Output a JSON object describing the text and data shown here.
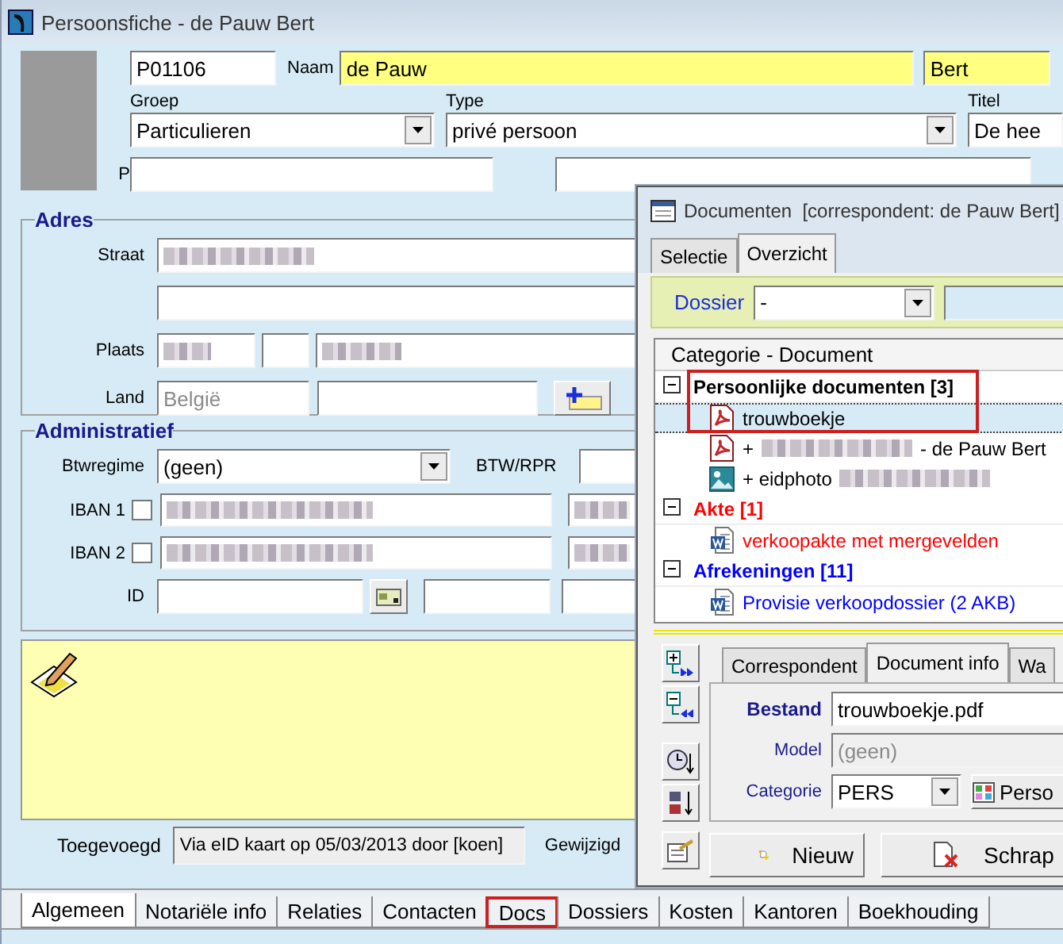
{
  "window": {
    "title": "Persoonsfiche - de Pauw Bert"
  },
  "header": {
    "code": "P01106",
    "name_label": "Naam",
    "name": "de Pauw",
    "first_name": "Bert",
    "group_label": "Groep",
    "group": "Particulieren",
    "type_label": "Type",
    "type": "privé persoon",
    "title_label": "Titel",
    "title": "De hee",
    "p_label": "P"
  },
  "address": {
    "heading": "Adres",
    "street_label": "Straat",
    "place_label": "Plaats",
    "country_label": "Land",
    "country": "België"
  },
  "administrative": {
    "heading": "Administratief",
    "vat_regime_label": "Btwregime",
    "vat_regime": "(geen)",
    "vat_label": "BTW/RPR",
    "id_label": "ID",
    "iban_rows": [
      {
        "label": "IBAN 1",
        "checked": false
      },
      {
        "label": "IBAN 2",
        "checked": false
      }
    ]
  },
  "footer": {
    "added_label": "Toegevoegd",
    "added": "Via eID kaart op 05/03/2013 door [koen]",
    "modified_label": "Gewijzigd"
  },
  "tabs": [
    {
      "label": "Algemeen",
      "selected": true,
      "highlighted": false
    },
    {
      "label": "Notariële info",
      "selected": false,
      "highlighted": false
    },
    {
      "label": "Relaties",
      "selected": false,
      "highlighted": false
    },
    {
      "label": "Contacten",
      "selected": false,
      "highlighted": false
    },
    {
      "label": "Docs",
      "selected": false,
      "highlighted": true
    },
    {
      "label": "Dossiers",
      "selected": false,
      "highlighted": false
    },
    {
      "label": "Kosten",
      "selected": false,
      "highlighted": false
    },
    {
      "label": "Kantoren",
      "selected": false,
      "highlighted": false
    },
    {
      "label": "Boekhouding",
      "selected": false,
      "highlighted": false
    }
  ],
  "documents_window": {
    "title": "Documenten  [correspondent: de Pauw Bert]",
    "tabs": [
      {
        "label": "Selectie",
        "selected": false
      },
      {
        "label": "Overzicht",
        "selected": true
      }
    ],
    "dossier_label": "Dossier",
    "dossier": "-",
    "tree_header": "Categorie - Document",
    "categories": [
      {
        "label": "Persoonlijke documenten [3]",
        "color": "#000000",
        "expanded": true,
        "highlighted": true,
        "children": [
          {
            "kind": "pdf",
            "prefix": "trouwboekje",
            "redacted": false,
            "selected": true
          },
          {
            "kind": "pdf",
            "prefix": "+",
            "redacted": true,
            "suffix": "- de Pauw Bert",
            "selected": false
          },
          {
            "kind": "image",
            "prefix": "+ eidphoto",
            "redacted": true,
            "selected": false
          }
        ]
      },
      {
        "label": "Akte [1]",
        "color": "#ff0000",
        "expanded": true,
        "highlighted": false,
        "children": [
          {
            "kind": "word",
            "prefix": "verkoopakte met mergevelden",
            "redacted": false,
            "selected": false
          }
        ]
      },
      {
        "label": "Afrekeningen [11]",
        "color": "#0000ff",
        "expanded": true,
        "highlighted": false,
        "children": [
          {
            "kind": "word",
            "prefix": "Provisie verkoopdossier (2 AKB)",
            "redacted": false,
            "selected": false
          }
        ]
      }
    ],
    "info_tabs": [
      {
        "label": "Correspondent",
        "selected": false
      },
      {
        "label": "Document info",
        "selected": true
      },
      {
        "label": "Wa",
        "selected": false
      }
    ],
    "file_label": "Bestand",
    "file": "trouwboekje.pdf",
    "model_label": "Model",
    "model": "(geen)",
    "category_label": "Categorie",
    "category": "PERS",
    "category_button": "Perso",
    "buttons": [
      {
        "kind": "new",
        "label": "Nieuw"
      },
      {
        "kind": "delete",
        "label": "Schrap"
      }
    ]
  }
}
